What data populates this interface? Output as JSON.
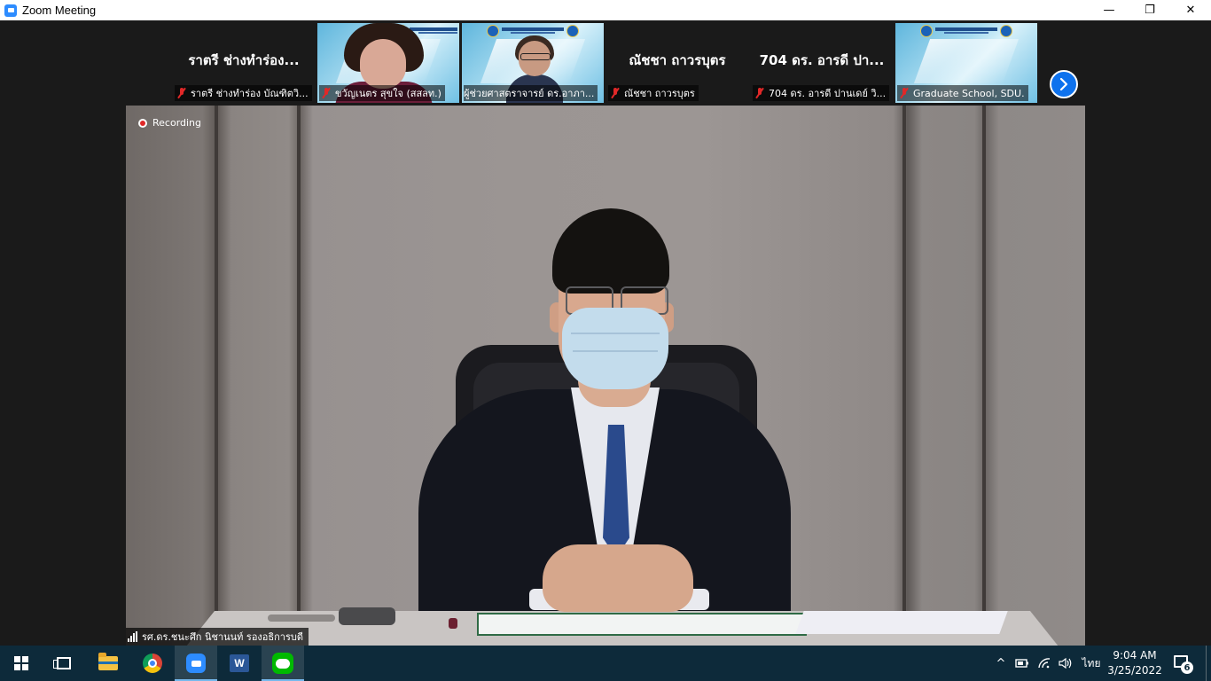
{
  "window": {
    "title": "Zoom Meeting",
    "minimize": "—",
    "restore": "❐",
    "close": "✕"
  },
  "gallery": {
    "tiles": [
      {
        "big_name": "ราตรี ช่างทำร่อง...",
        "label": "ราตรี ช่างทำร่อง บัณฑิตวิ..."
      },
      {
        "big_name": "",
        "label": "ขวัญเนตร  สุขใจ (สสลท.)"
      },
      {
        "big_name": "",
        "label": "ผู้ช่วยศาสตราจารย์ ดร.อาภา..."
      },
      {
        "big_name": "ณัชชา ถาวรบุตร",
        "label": "ณัชชา ถาวรบุตร"
      },
      {
        "big_name": "704 ดร. อารดี ปา...",
        "label": "704 ดร. อารดี ปานเดย์ วิ..."
      },
      {
        "big_name": "",
        "label": "Graduate School, SDU."
      }
    ],
    "next_icon": "chevron-right-icon"
  },
  "main_video": {
    "recording_label": "Recording",
    "speaker_label": "รศ.ดร.ชนะศึก นิชานนท์ รองอธิการบดี"
  },
  "taskbar": {
    "apps": [
      "windows-start",
      "task-view",
      "file-explorer",
      "chrome",
      "zoom",
      "word",
      "line"
    ],
    "word_letter": "W",
    "tray": {
      "chevron": "^",
      "language": "ไทย",
      "time": "9:04 AM",
      "date": "3/25/2022",
      "notification_count": "6"
    }
  },
  "colors": {
    "zoom_blue": "#2d8cff",
    "next_button": "#0e72ed",
    "mic_muted_red": "#e02828",
    "taskbar_bg": "#0d2a3a",
    "stage_bg": "#1a1a1a"
  }
}
